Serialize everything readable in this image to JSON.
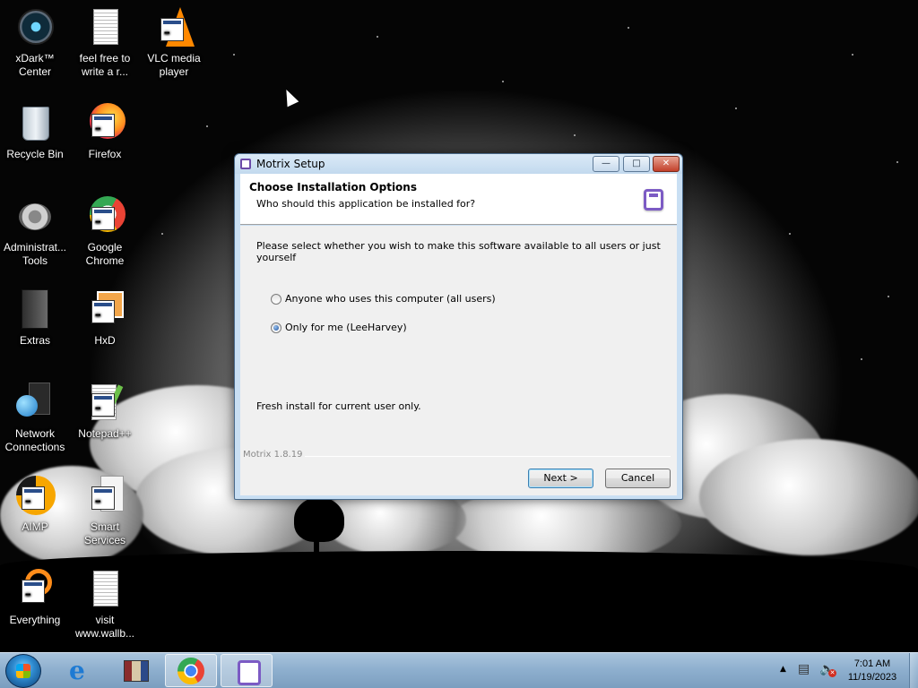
{
  "desktop": {
    "icons": [
      {
        "label": "xDark™\nCenter",
        "icon": "xdark-center-icon"
      },
      {
        "label": "feel free to\nwrite a r...",
        "icon": "text-document-icon"
      },
      {
        "label": "VLC media\nplayer",
        "icon": "vlc-icon"
      },
      {
        "label": "Recycle Bin",
        "icon": "recycle-bin-icon"
      },
      {
        "label": "Firefox",
        "icon": "firefox-icon"
      },
      {
        "label": "Administrat...\nTools",
        "icon": "admin-tools-icon"
      },
      {
        "label": "Google\nChrome",
        "icon": "chrome-icon"
      },
      {
        "label": "Extras",
        "icon": "folder-icon"
      },
      {
        "label": "HxD",
        "icon": "hxd-icon"
      },
      {
        "label": "Network\nConnections",
        "icon": "network-icon"
      },
      {
        "label": "Notepad++",
        "icon": "notepad-plus-plus-icon"
      },
      {
        "label": "AIMP",
        "icon": "aimp-icon"
      },
      {
        "label": "Smart\nServices",
        "icon": "smart-services-icon"
      },
      {
        "label": "Everything",
        "icon": "everything-search-icon"
      },
      {
        "label": "visit\nwww.wallb...",
        "icon": "text-document-icon"
      }
    ]
  },
  "dialog": {
    "title": "Motrix Setup",
    "controls": {
      "minimize": "—",
      "maximize": "□",
      "close": "✕"
    },
    "header": {
      "title": "Choose Installation Options",
      "subtitle": "Who should this application be installed for?"
    },
    "body": {
      "description": "Please select whether you wish to make this software available to all users or just yourself",
      "options": [
        {
          "label": "Anyone who uses this computer (all users)",
          "checked": false
        },
        {
          "label": "Only for me (LeeHarvey)",
          "checked": true
        }
      ],
      "status": "Fresh install for current user only."
    },
    "version": "Motrix 1.8.19",
    "buttons": {
      "next": "Next >",
      "cancel": "Cancel"
    }
  },
  "taskbar": {
    "apps": [
      "internet-explorer-icon",
      "archive-manager-icon",
      "chrome-icon",
      "motrix-icon"
    ],
    "active_app": "motrix-icon",
    "clock": {
      "time": "7:01 AM",
      "date": "11/19/2023"
    },
    "tray": [
      "show-hidden-icons-icon",
      "network-status-icon",
      "volume-muted-icon"
    ]
  },
  "colors": {
    "accent": "#7c5bc4",
    "taskbar": "#8fb0cf",
    "dialog_frame": "#c9dff3"
  }
}
